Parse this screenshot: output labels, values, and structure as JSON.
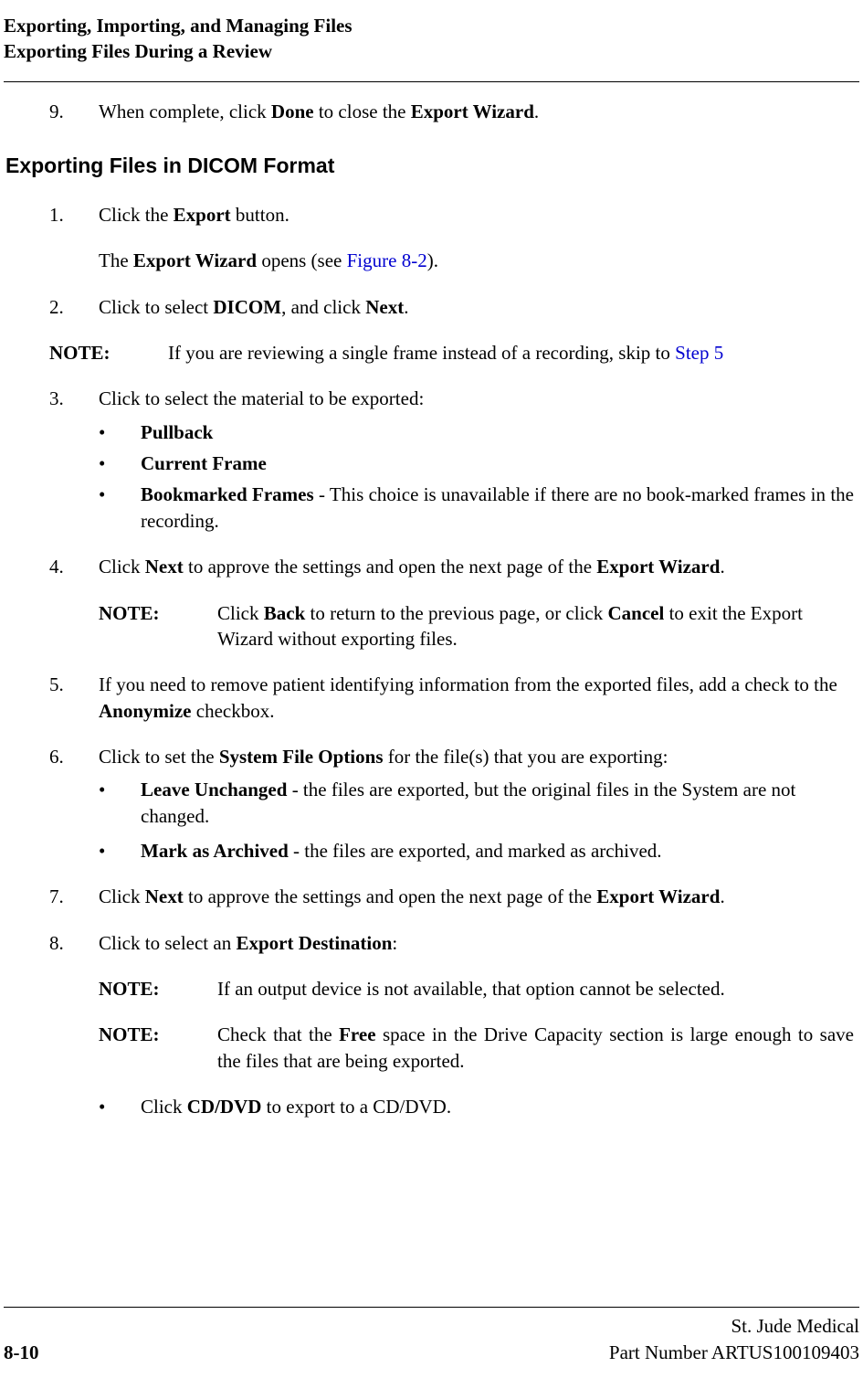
{
  "header": {
    "line1": "Exporting, Importing, and Managing Files",
    "line2": "Exporting Files During a Review"
  },
  "intro_step": {
    "num": "9.",
    "pre": "When complete, click ",
    "b1": "Done",
    "mid": " to close the ",
    "b2": "Export Wizard",
    "post": "."
  },
  "section_title": "Exporting Files in DICOM Format",
  "s1": {
    "num": "1.",
    "pre": "Click the ",
    "b1": "Export",
    "post": " button."
  },
  "s1_sub": {
    "pre": "The ",
    "b1": "Export Wizard",
    "mid": " opens (see ",
    "link": "Figure 8-2",
    "post": ")."
  },
  "s2": {
    "num": "2.",
    "pre": "Click to select ",
    "b1": "DICOM",
    "mid": ", and click ",
    "b2": "Next",
    "post": "."
  },
  "note1": {
    "label": "NOTE:",
    "pre": "If you are reviewing a single frame instead of a recording, skip to ",
    "link": "Step 5"
  },
  "s3": {
    "num": "3.",
    "text": "Click to select the material to be exported:"
  },
  "b3a": {
    "mark": "•",
    "b": "Pullback"
  },
  "b3b": {
    "mark": "•",
    "b": "Current Frame"
  },
  "b3c": {
    "mark": "•",
    "b": "Bookmarked Frames",
    "post": " - This choice is unavailable if there are no book-marked frames in the recording."
  },
  "s4": {
    "num": "4.",
    "pre": "Click ",
    "b1": "Next",
    "mid": " to approve the settings and open the next page of the ",
    "b2": "Export Wizard",
    "post": "."
  },
  "note2": {
    "label": "NOTE:",
    "pre": "Click ",
    "b1": "Back",
    "mid": " to return to the previous page, or click ",
    "b2": "Cancel",
    "post": " to exit the Export Wizard without exporting files."
  },
  "s5": {
    "num": "5.",
    "pre": "If you need to remove patient identifying information from the exported files, add a check to the ",
    "b1": "Anonymize",
    "post": " checkbox."
  },
  "s6": {
    "num": "6.",
    "pre": "Click to set the ",
    "b1": "System File Options",
    "post": " for the file(s) that you are exporting:"
  },
  "b6a": {
    "mark": "•",
    "b": "Leave Unchanged",
    "post": " - the files are exported, but the original files in the System are not changed."
  },
  "b6b": {
    "mark": "•",
    "b": "Mark as Archived",
    "post": " - the files are exported, and marked as archived."
  },
  "s7": {
    "num": "7.",
    "pre": "Click ",
    "b1": "Next",
    "mid": " to approve the settings and open the next page of the ",
    "b2": "Export Wizard",
    "post": "."
  },
  "s8": {
    "num": "8.",
    "pre": "Click to select an  ",
    "b1": "Export Destination",
    "post": ":"
  },
  "note3": {
    "label": "NOTE:",
    "text": "If an output device is not available, that option cannot be selected."
  },
  "note4": {
    "label": "NOTE:",
    "pre": "Check that the ",
    "b1": "Free",
    "post": " space in the Drive Capacity section is large enough to save the files that are being exported."
  },
  "b8a": {
    "mark": "•",
    "pre": "Click ",
    "b": "CD/DVD",
    "post": " to export to a CD/DVD."
  },
  "footer": {
    "page": "8-10",
    "company": "St. Jude Medical",
    "part": "Part Number ARTUS100109403"
  }
}
